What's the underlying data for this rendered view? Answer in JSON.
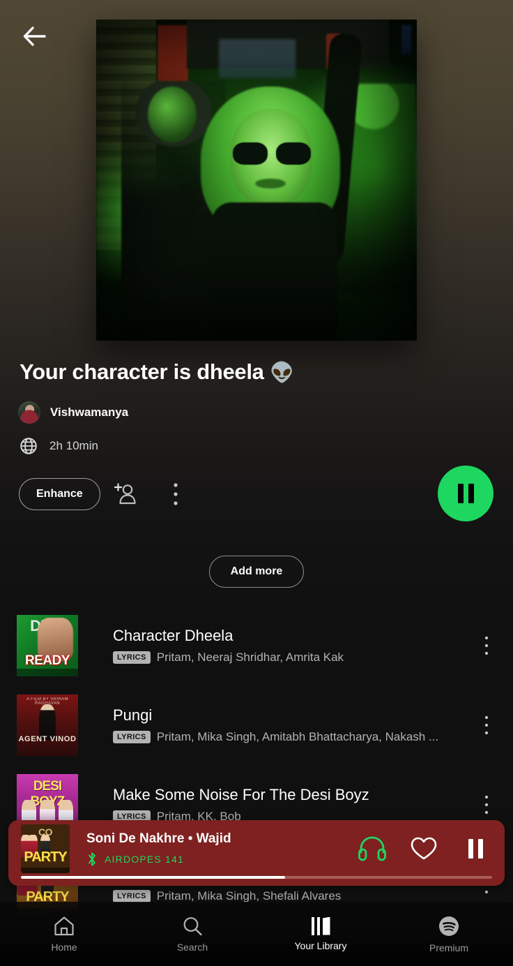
{
  "header": {
    "back_icon": "back-arrow-icon"
  },
  "playlist": {
    "cover_alt": "green-lit nightclub crowd photo",
    "title": "Your character is dheela",
    "title_emoji": "👽",
    "owner": "Vishwamanya",
    "visibility_icon": "globe-icon",
    "duration": "2h 10min",
    "enhance_label": "Enhance",
    "add_people_icon": "add-person-icon",
    "more_icon": "more-options-icon",
    "play_icon": "pause-icon",
    "add_more_label": "Add more"
  },
  "tracks": [
    {
      "title": "Character Dheela",
      "badge": "LYRICS",
      "artists": "Pritam, Neeraj Shridhar, Amrita Kak",
      "album_art": "READY",
      "art_top_text": "DIKA",
      "art_bottom_text": "READY"
    },
    {
      "title": "Pungi",
      "badge": "LYRICS",
      "artists": "Pritam, Mika Singh, Amitabh Bhattacharya, Nakash ...",
      "album_art": "AGENT VINOD",
      "art_top_text": "A FILM BY SRIRAM RAGHAVAN",
      "art_bottom_text": "AGENT VINOD"
    },
    {
      "title": "Make Some Noise For The Desi Boyz",
      "badge": "LYRICS",
      "artists": "Pritam, KK, Bob",
      "album_art": "DESI BOYZ",
      "art_top_text": "DESI BOYZ",
      "art_bottom_text": ""
    },
    {
      "title": "Soni De Nakhre",
      "badge": "LYRICS",
      "artists": "Pritam, Mika Singh, Shefali Alvares",
      "album_art": "PARTY",
      "art_top_text": "CO",
      "art_bottom_text": "PARTY"
    }
  ],
  "now_playing": {
    "track": "Soni De Nakhre",
    "separator": "•",
    "artist": "Wajid",
    "title_line": "Soni De Nakhre • Wajid",
    "bluetooth_icon": "bluetooth-icon",
    "device": "AIRDOPES 141",
    "device_color": "#1ed760",
    "headphones_icon": "headphones-icon",
    "like_icon": "heart-outline-icon",
    "pause_icon": "pause-icon",
    "progress_percent": 56,
    "bar_color": "#7e2120",
    "art_top_text": "CO",
    "art_bottom_text": "PARTY"
  },
  "bottom_nav": {
    "items": [
      {
        "label": "Home",
        "icon": "home-icon",
        "active": false
      },
      {
        "label": "Search",
        "icon": "search-icon",
        "active": false
      },
      {
        "label": "Your Library",
        "icon": "library-icon",
        "active": true
      },
      {
        "label": "Premium",
        "icon": "spotify-logo-icon",
        "active": false
      }
    ]
  },
  "theme": {
    "accent_green": "#1ed760",
    "background_top": "#504734",
    "background_bottom": "#101010",
    "muted_text": "#b3b3b3"
  }
}
